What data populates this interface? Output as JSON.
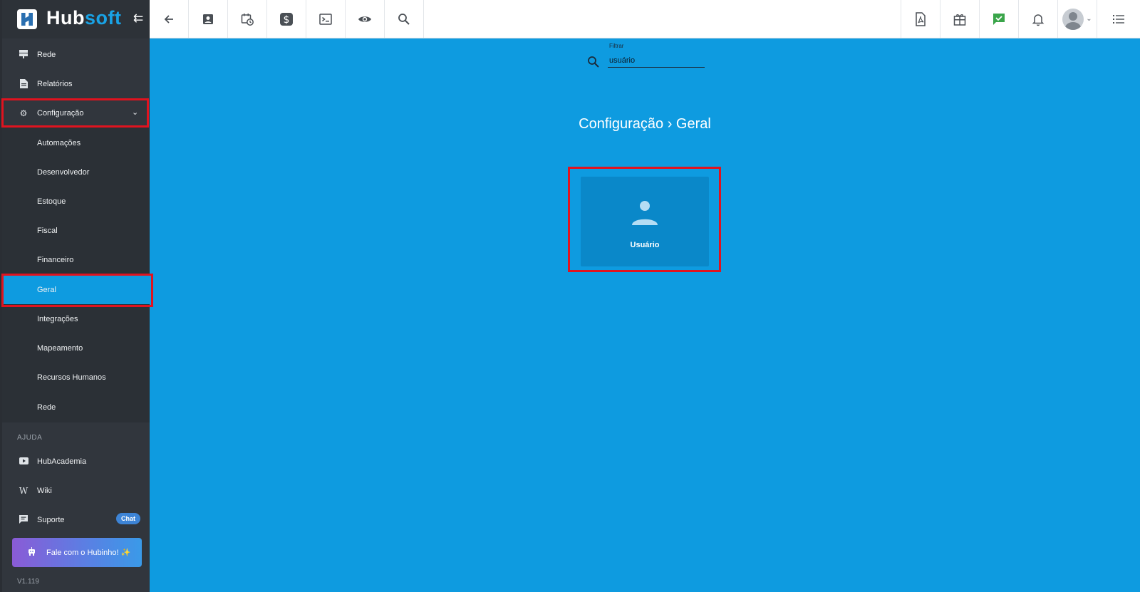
{
  "app": {
    "logo_primary": "Hub",
    "logo_secondary": "soft",
    "brand_color": "#19a3e6",
    "highlight_color": "#e0131f"
  },
  "sidebar": {
    "items": [
      {
        "label": "Rede",
        "icon": "network-icon"
      },
      {
        "label": "Relatórios",
        "icon": "report-icon"
      },
      {
        "label": "Configuração",
        "icon": "gear-icon",
        "expanded": true
      }
    ],
    "submenu": [
      {
        "label": "Automações"
      },
      {
        "label": "Desenvolvedor"
      },
      {
        "label": "Estoque"
      },
      {
        "label": "Fiscal"
      },
      {
        "label": "Financeiro"
      },
      {
        "label": "Geral",
        "active": true
      },
      {
        "label": "Integrações"
      },
      {
        "label": "Mapeamento"
      },
      {
        "label": "Recursos Humanos"
      },
      {
        "label": "Rede"
      }
    ],
    "help_section": "AJUDA",
    "help_items": [
      {
        "label": "HubAcademia",
        "icon": "youtube-icon"
      },
      {
        "label": "Wiki",
        "icon": "wikipedia-icon"
      },
      {
        "label": "Suporte",
        "icon": "chat-icon",
        "badge": "Chat"
      }
    ],
    "hubinho_button": "Fale com o Hubinho! ✨",
    "version": "V1.119"
  },
  "topbar": {
    "left_icons": [
      "back-arrow-icon",
      "contact-card-icon",
      "calendar-clock-icon",
      "dollar-icon",
      "terminal-icon",
      "eye-icon",
      "search-icon"
    ],
    "right_icons": [
      "pdf-file-icon",
      "gift-icon",
      "check-message-icon",
      "bell-icon",
      "user-avatar",
      "menu-list-icon"
    ]
  },
  "main": {
    "filter": {
      "label": "Filtrar",
      "value": "usuário"
    },
    "title": "Configuração › Geral",
    "cards": [
      {
        "label": "Usuário",
        "icon": "user-icon"
      }
    ]
  }
}
